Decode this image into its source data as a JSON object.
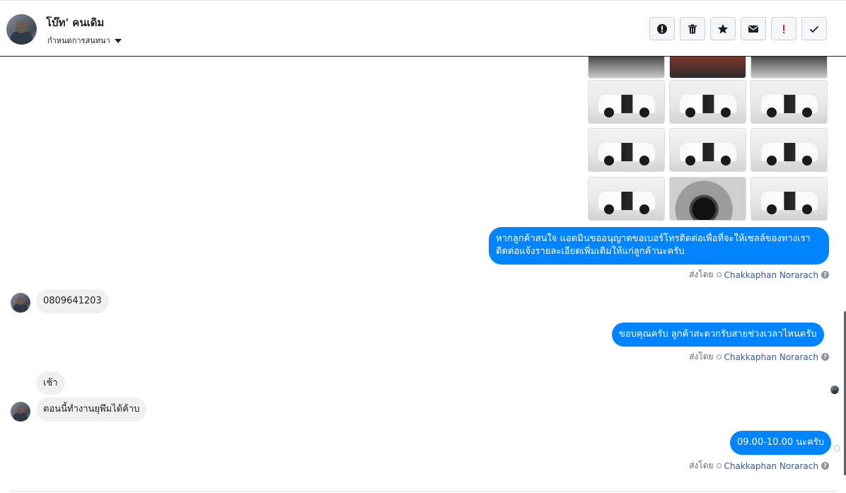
{
  "header": {
    "contact_name": "โบ๊ท' คนเดิม",
    "subtitle": "กำหนดการสนทนา",
    "toolbar": [
      {
        "name": "alert-icon",
        "label": "!"
      },
      {
        "name": "trash-icon",
        "label": ""
      },
      {
        "name": "star-icon",
        "label": ""
      },
      {
        "name": "mail-icon",
        "label": ""
      },
      {
        "name": "important-icon",
        "label": "!"
      },
      {
        "name": "checkmark-icon",
        "label": ""
      }
    ]
  },
  "messages": {
    "outgoing_1": "หากลูกค้าสนใจ แอดมินขออนุญาตขอเบอร์โทรติดต่อเพื่อที่จะให้เซลล์ของทางเราติดต่อแจ้งรายละเอียดเพิ่มเติมให้แก่ลูกค้านะครับ",
    "outgoing_1_line1": "หากลูกค้าสนใจ แอดมินขออนุญาตขอเบอร์โทรติดต่อเพื่อที่จะให้เซลล์ของทางเรา",
    "outgoing_1_line2": "ติดต่อแจ้งรายละเอียดเพิ่มเติมให้แก่ลูกค้านะครับ",
    "incoming_1": "0809641203",
    "outgoing_2": "ขอบคุณครับ ลูกค้าสะดวกรับสายช่วงเวลาไหนครับ",
    "incoming_2": "เช้า",
    "incoming_3": "ตอนนี้ทำงานยุพึมได้ค้าบ",
    "outgoing_3": "09.00-10.00 นะครับ"
  },
  "sent_by": {
    "prefix": "ส่งโดย",
    "agent": "Chakkaphan Norarach",
    "help": "?"
  },
  "colors": {
    "outgoing_bubble": "#0084ff",
    "incoming_bubble": "#f1f0f0",
    "agent_link": "#385898"
  }
}
